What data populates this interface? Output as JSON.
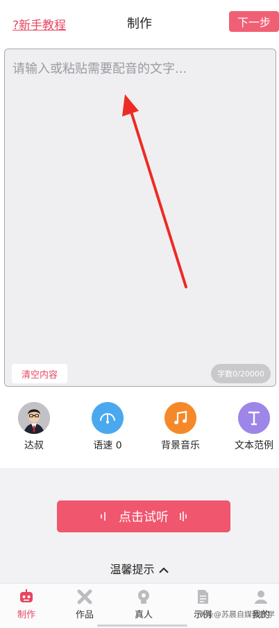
{
  "header": {
    "tutorial_link": "?新手教程",
    "title": "制作",
    "next_button": "下一步"
  },
  "editor": {
    "placeholder": "请输入或粘贴需要配音的文字...",
    "clear_button": "清空内容",
    "char_count": "字数0/20000"
  },
  "tools": [
    {
      "label": "达叔",
      "icon": "voice-avatar"
    },
    {
      "label": "语速 0",
      "icon": "speed-gauge-icon"
    },
    {
      "label": "背景音乐",
      "icon": "music-note-icon"
    },
    {
      "label": "文本范例",
      "icon": "text-t-icon"
    }
  ],
  "play": {
    "label": "点击试听"
  },
  "tips": {
    "label": "温馨提示"
  },
  "tabbar": [
    {
      "label": "制作",
      "icon": "robot-icon",
      "active": true
    },
    {
      "label": "作品",
      "icon": "works-icon"
    },
    {
      "label": "真人",
      "icon": "person-head-icon"
    },
    {
      "label": "示例",
      "icon": "document-icon"
    },
    {
      "label": "我的",
      "icon": "user-icon"
    }
  ],
  "watermark": "头条@苏晨自媒体教学",
  "colors": {
    "accent": "#f06075",
    "link": "#e8455f",
    "speed_icon_bg": "#4aa8ef",
    "music_icon_bg": "#f5892a",
    "text_icon_bg": "#9d86e8"
  }
}
